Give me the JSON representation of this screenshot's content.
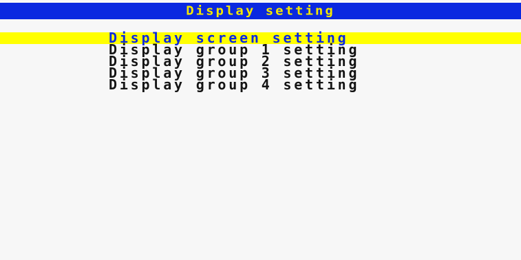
{
  "header": {
    "title": "Display setting"
  },
  "colors": {
    "title_bar_bg": "#0a28e0",
    "title_text": "#f5e800",
    "selection_bg": "#ffff00",
    "selected_text": "#0a28e0",
    "item_text": "#141414",
    "screen_bg": "#f7f7f7"
  },
  "menu": {
    "selected_index": 0,
    "items": [
      {
        "label": "Display screen setting"
      },
      {
        "label": "Display group 1 setting"
      },
      {
        "label": "Display group 2 setting"
      },
      {
        "label": "Display group 3 setting"
      },
      {
        "label": "Display group 4 setting"
      }
    ]
  }
}
